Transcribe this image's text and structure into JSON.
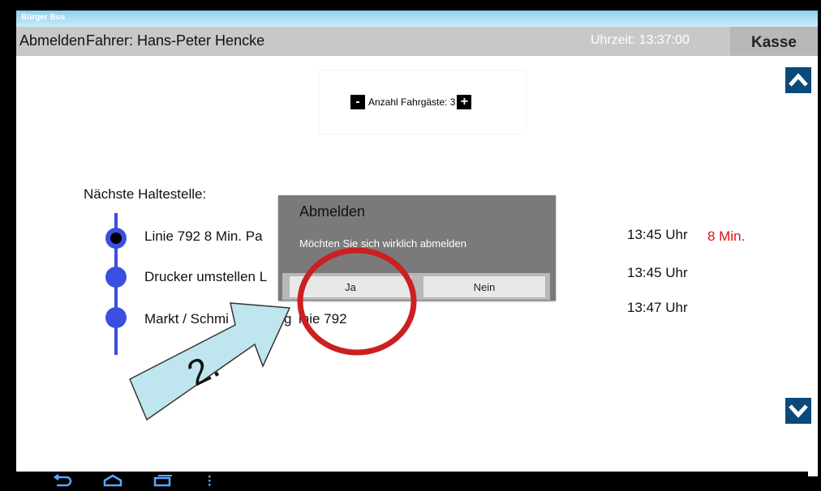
{
  "app": {
    "title": "Bürger Bus"
  },
  "header": {
    "logout_label": "Abmelden",
    "driver_label": "Fahrer: Hans-Peter Hencke",
    "clock": "Uhrzeit: 13:37:00",
    "kasse_label": "Kasse"
  },
  "passengers": {
    "minus": "-",
    "label": "Anzahl Fahrgäste: 3",
    "plus": "+"
  },
  "next_stop_label": "Nächste Haltestelle:",
  "stops": [
    {
      "name": "Linie 792  8 Min. Pa",
      "time": "13:45 Uhr",
      "delay": "8 Min."
    },
    {
      "name": "Drucker umstellen L",
      "time": "13:45 Uhr"
    },
    {
      "name": "Markt / Schmi",
      "name_tail": "g",
      "name_line": "inie 792",
      "time": "13:47 Uhr"
    }
  ],
  "dialog": {
    "title": "Abmelden",
    "message": "Möchten Sie sich wirklich abmelden",
    "yes": "Ja",
    "no": "Nein"
  },
  "annotation": {
    "step_label": "2.",
    "circle_color": "#cc1f1f",
    "arrow_color": "#bfe5ef"
  },
  "colors": {
    "accent_blue": "#3a4fe0",
    "delay_red": "#e01010",
    "scroll_button": "#0a4a7a"
  },
  "icons": [
    "chevron-up-icon",
    "chevron-down-icon",
    "back-icon",
    "home-icon",
    "recents-icon",
    "menu-icon"
  ]
}
